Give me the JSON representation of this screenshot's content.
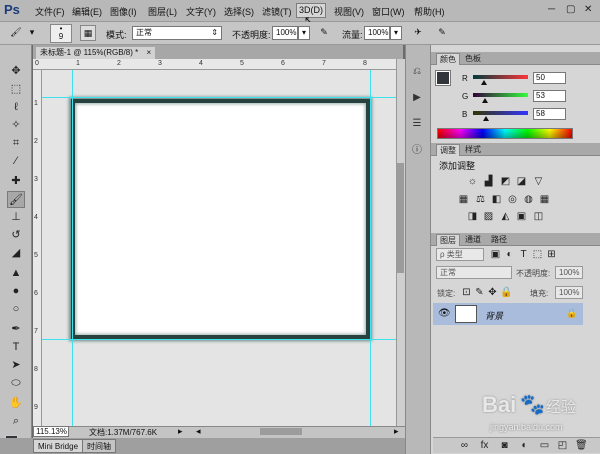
{
  "app": {
    "logo": "Ps"
  },
  "menu": {
    "items": [
      "文件(F)",
      "编辑(E)",
      "图像(I)",
      "图层(L)",
      "文字(Y)",
      "选择(S)",
      "滤镜(T)",
      "3D(D)",
      "视图(V)",
      "窗口(W)",
      "帮助(H)"
    ],
    "highlighted": "3D(D)"
  },
  "window_controls": [
    "─",
    "▢",
    "✕"
  ],
  "options_bar": {
    "brush_size": "9",
    "mode_label": "模式:",
    "mode_value": "正常",
    "opacity_label": "不透明度:",
    "opacity_value": "100%",
    "flow_label": "流量:",
    "flow_value": "100%"
  },
  "document": {
    "tab_title": "未标题-1 @ 115%(RGB/8) *",
    "close_glyph": "×"
  },
  "rulers": {
    "top": [
      "0",
      "1",
      "2",
      "3",
      "4",
      "5",
      "6",
      "7",
      "8",
      "9"
    ],
    "left": [
      "0",
      "1",
      "2",
      "3",
      "4",
      "5",
      "6",
      "7",
      "8",
      "9"
    ]
  },
  "status": {
    "zoom": "115.13%",
    "doc_info": "文档:1.37M/767.6K"
  },
  "bottom_tabs": [
    "Mini Bridge",
    "时间轴"
  ],
  "color_panel": {
    "tabs": [
      "颜色",
      "色板"
    ],
    "r_label": "R",
    "r_value": "50",
    "g_label": "G",
    "g_value": "53",
    "b_label": "B",
    "b_value": "58",
    "foreground": "#32353a"
  },
  "adjust_panel": {
    "tabs": [
      "调整",
      "样式"
    ],
    "title": "添加调整"
  },
  "layers_panel": {
    "tabs": [
      "图层",
      "通道",
      "路径"
    ],
    "filter_label": "ρ 类型",
    "blend_mode": "正常",
    "opacity_label": "不透明度:",
    "opacity_value": "100%",
    "lock_label": "锁定:",
    "fill_label": "填充:",
    "fill_value": "100%",
    "layer_name": "背景"
  },
  "watermark": {
    "brand": "Bai",
    "brand_suffix": "经验",
    "url": "jingyan.baidu.com"
  }
}
